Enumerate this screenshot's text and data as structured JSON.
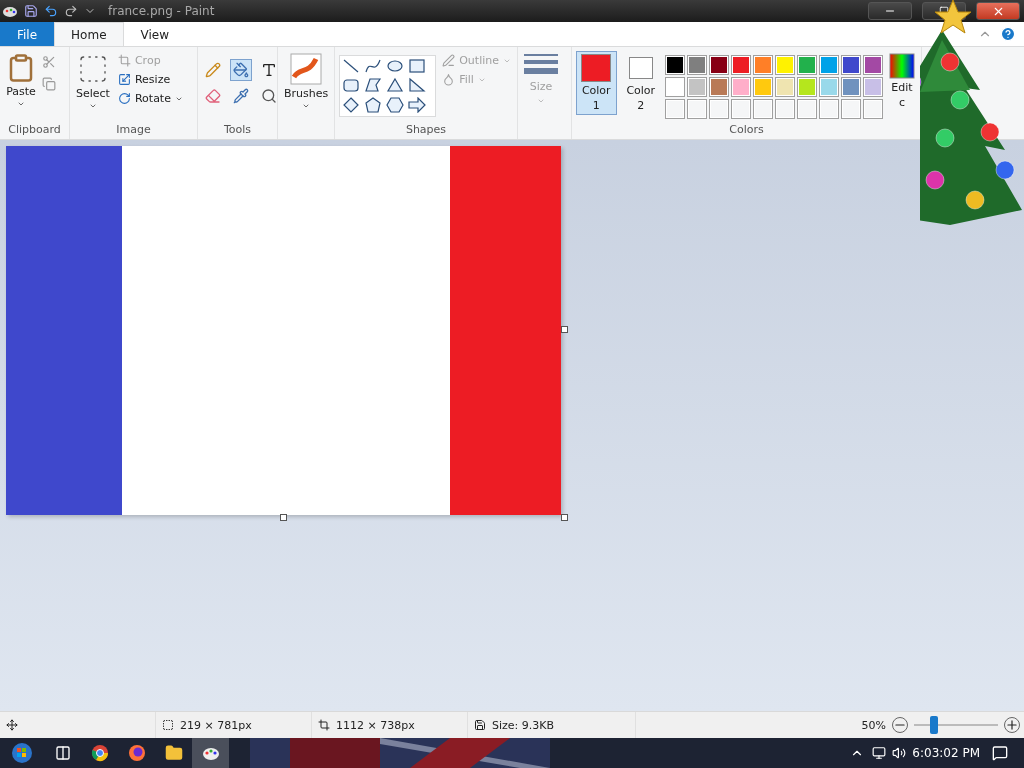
{
  "window": {
    "title": "france.png - Paint"
  },
  "tabs": [
    {
      "label": "File",
      "kind": "file",
      "selected": false
    },
    {
      "label": "Home",
      "kind": "tab",
      "selected": true
    },
    {
      "label": "View",
      "kind": "tab",
      "selected": false
    }
  ],
  "ribbon": {
    "clipboard": {
      "label": "Clipboard",
      "paste": "Paste"
    },
    "image": {
      "label": "Image",
      "select": "Select",
      "crop": {
        "label": "Crop",
        "disabled": true
      },
      "resize": {
        "label": "Resize",
        "disabled": false
      },
      "rotate": {
        "label": "Rotate",
        "disabled": false
      }
    },
    "tools": {
      "label": "Tools",
      "items": [
        {
          "kind": "pencil",
          "selected": false
        },
        {
          "kind": "fill",
          "selected": true
        },
        {
          "kind": "text",
          "selected": false
        },
        {
          "kind": "eraser",
          "selected": false
        },
        {
          "kind": "picker",
          "selected": false
        },
        {
          "kind": "magnifier",
          "selected": false
        }
      ]
    },
    "brushes": {
      "button": "Brushes"
    },
    "shapes": {
      "label": "Shapes",
      "outline": {
        "label": "Outline",
        "disabled": true
      },
      "fill": {
        "label": "Fill",
        "disabled": true
      }
    },
    "size": {
      "label": "Size",
      "disabled": true
    },
    "colors": {
      "label": "Colors",
      "color1": {
        "label": "Color",
        "number": "1",
        "color": "#ed1c24",
        "selected": true
      },
      "color2": {
        "label": "Color",
        "number": "2",
        "color": "#ffffff",
        "selected": false
      },
      "palette": [
        {
          "kind": "swatch",
          "color": "#000000"
        },
        {
          "kind": "swatch",
          "color": "#7f7f7f"
        },
        {
          "kind": "swatch",
          "color": "#880015"
        },
        {
          "kind": "swatch",
          "color": "#ed1c24"
        },
        {
          "kind": "swatch",
          "color": "#ff7f27"
        },
        {
          "kind": "swatch",
          "color": "#fff200"
        },
        {
          "kind": "swatch",
          "color": "#22b14c"
        },
        {
          "kind": "swatch",
          "color": "#00a2e8"
        },
        {
          "kind": "swatch",
          "color": "#3f48cc"
        },
        {
          "kind": "swatch",
          "color": "#a349a4"
        },
        {
          "kind": "swatch",
          "color": "#ffffff"
        },
        {
          "kind": "swatch",
          "color": "#c3c3c3"
        },
        {
          "kind": "swatch",
          "color": "#b97a57"
        },
        {
          "kind": "swatch",
          "color": "#ffaec9"
        },
        {
          "kind": "swatch",
          "color": "#ffc90e"
        },
        {
          "kind": "swatch",
          "color": "#efe4b0"
        },
        {
          "kind": "swatch",
          "color": "#b5e61d"
        },
        {
          "kind": "swatch",
          "color": "#99d9ea"
        },
        {
          "kind": "swatch",
          "color": "#7092be"
        },
        {
          "kind": "swatch",
          "color": "#c8bfe7"
        },
        {
          "kind": "empty"
        },
        {
          "kind": "empty"
        },
        {
          "kind": "empty"
        },
        {
          "kind": "empty"
        },
        {
          "kind": "empty"
        },
        {
          "kind": "empty"
        },
        {
          "kind": "empty"
        },
        {
          "kind": "empty"
        },
        {
          "kind": "empty"
        },
        {
          "kind": "empty"
        }
      ],
      "edit": [
        "Edit",
        "c"
      ]
    }
  },
  "canvas": {
    "stripes": [
      {
        "color": "#3f48cc"
      },
      {
        "color": "#ffffff"
      },
      {
        "color": "#ed1c24"
      }
    ]
  },
  "status_bar": {
    "selection": "219 × 781px",
    "image_size": "1112 × 738px",
    "file_size": "Size: 9.3KB",
    "zoom": "50%",
    "zoom_level": {
      "level": 0.24
    }
  },
  "taskbar": {
    "apps": [
      {
        "kind": "taskview",
        "selected": false
      },
      {
        "kind": "chrome",
        "selected": false
      },
      {
        "kind": "firefox",
        "selected": false
      },
      {
        "kind": "folder",
        "selected": false
      },
      {
        "kind": "paint",
        "selected": true
      }
    ],
    "clock": "6:03:02 PM"
  }
}
